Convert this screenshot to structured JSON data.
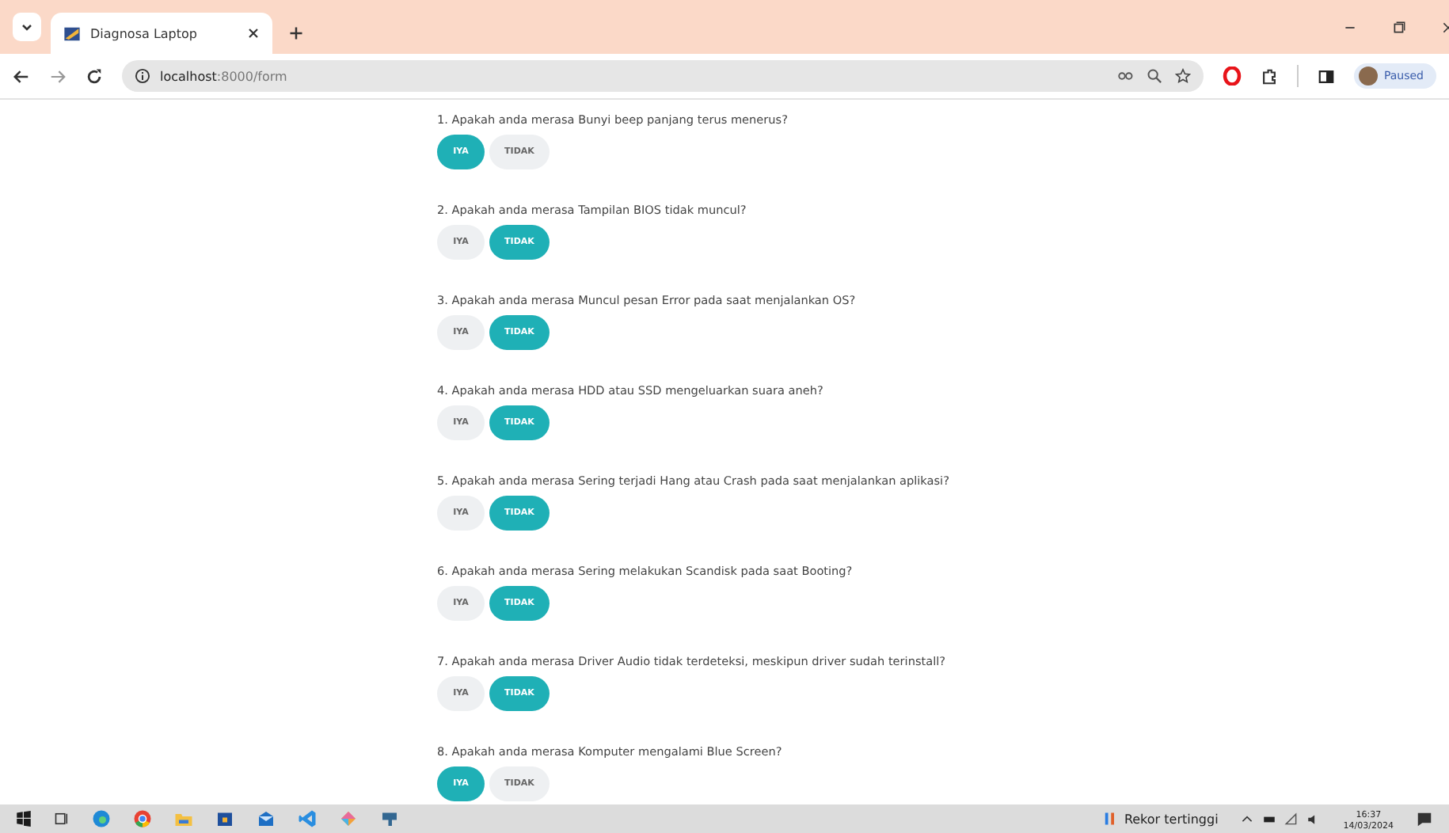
{
  "browser": {
    "tab_title": "Diagnosa Laptop",
    "url_host": "localhost",
    "url_path": ":8000/form",
    "profile": "Paused"
  },
  "questions": [
    {
      "text": "1. Apakah anda merasa Bunyi beep panjang terus menerus?",
      "answers": [
        {
          "label": "IYA",
          "selected": true
        },
        {
          "label": "TIDAK",
          "selected": false
        }
      ]
    },
    {
      "text": "2. Apakah anda merasa Tampilan BIOS tidak muncul?",
      "answers": [
        {
          "label": "IYA",
          "selected": false
        },
        {
          "label": "TIDAK",
          "selected": true
        }
      ]
    },
    {
      "text": "3. Apakah anda merasa Muncul pesan Error pada saat menjalankan OS?",
      "answers": [
        {
          "label": "IYA",
          "selected": false
        },
        {
          "label": "TIDAK",
          "selected": true
        }
      ]
    },
    {
      "text": "4. Apakah anda merasa HDD atau SSD mengeluarkan suara aneh?",
      "answers": [
        {
          "label": "IYA",
          "selected": false
        },
        {
          "label": "TIDAK",
          "selected": true
        }
      ]
    },
    {
      "text": "5. Apakah anda merasa Sering terjadi Hang atau Crash pada saat menjalankan aplikasi?",
      "answers": [
        {
          "label": "IYA",
          "selected": false
        },
        {
          "label": "TIDAK",
          "selected": true
        }
      ]
    },
    {
      "text": "6. Apakah anda merasa Sering melakukan Scandisk pada saat Booting?",
      "answers": [
        {
          "label": "IYA",
          "selected": false
        },
        {
          "label": "TIDAK",
          "selected": true
        }
      ]
    },
    {
      "text": "7. Apakah anda merasa Driver Audio tidak terdeteksi, meskipun driver sudah terinstall?",
      "answers": [
        {
          "label": "IYA",
          "selected": false
        },
        {
          "label": "TIDAK",
          "selected": true
        }
      ]
    },
    {
      "text": "8. Apakah anda merasa Komputer mengalami Blue Screen?",
      "answers": [
        {
          "label": "IYA",
          "selected": true
        },
        {
          "label": "TIDAK",
          "selected": false
        }
      ]
    }
  ],
  "taskbar": {
    "weather": "Rekor tertinggi",
    "time": "16:37",
    "date": "14/03/2024"
  }
}
